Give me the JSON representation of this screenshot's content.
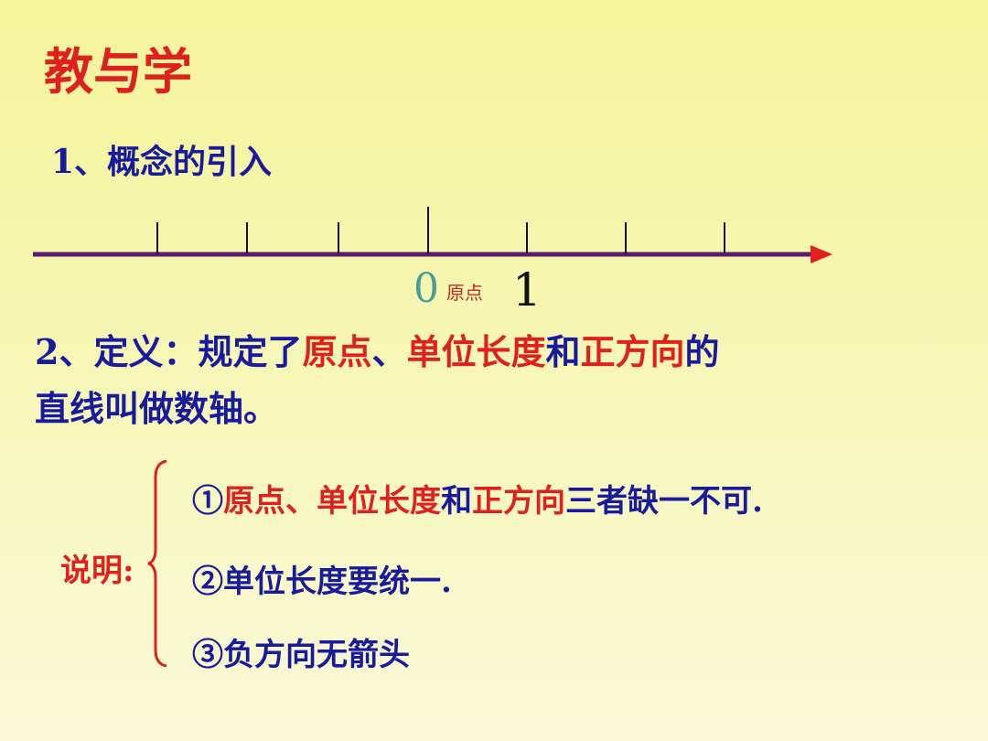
{
  "title": "教与学",
  "section1": "1、概念的引入",
  "number_line": {
    "zero_label": "0",
    "origin_label": "原点",
    "one_label": "1",
    "colors": {
      "axis": "#5a1a6e",
      "arrow": "#e0201e",
      "ticks": "#111111"
    }
  },
  "definition": {
    "line1": {
      "p1": "2、定义：规定了",
      "p2": "原点",
      "p3": "、",
      "p4": "单位长度",
      "p5": "和",
      "p6": "正方向",
      "p7": "的"
    },
    "line2": "直线叫做数轴。"
  },
  "explanation": {
    "label": "说明:",
    "note1": {
      "p1": "①",
      "p2": "原点、单位长度",
      "p3": "和",
      "p4": "正方向",
      "p5": "三者缺一不可."
    },
    "note2": "②单位长度要统一.",
    "note3": "③负方向无箭头"
  }
}
